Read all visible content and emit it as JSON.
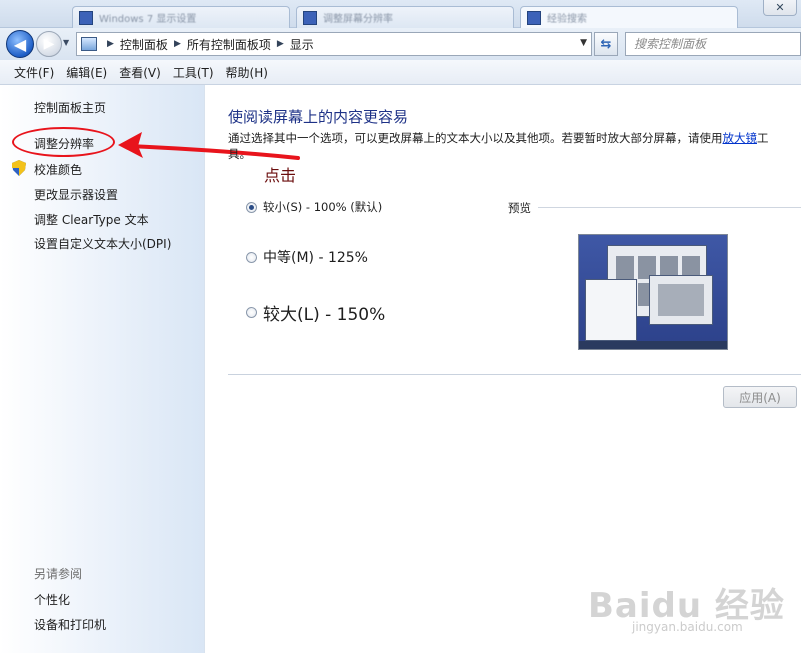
{
  "tabs": [
    {
      "label": "Windows 7 显示设置"
    },
    {
      "label": "调整屏幕分辨率"
    },
    {
      "label": "经验搜索"
    }
  ],
  "window": {
    "close_label": "✕"
  },
  "address": {
    "crumbs": [
      "控制面板",
      "所有控制面板项",
      "显示"
    ],
    "search_placeholder": "搜索控制面板"
  },
  "menu": [
    "文件(F)",
    "编辑(E)",
    "查看(V)",
    "工具(T)",
    "帮助(H)"
  ],
  "sidebar": {
    "home": "控制面板主页",
    "items": [
      {
        "label": "调整分辨率"
      },
      {
        "label": "校准颜色",
        "icon": "shield-icon"
      },
      {
        "label": "更改显示器设置"
      },
      {
        "label": "调整 ClearType 文本"
      },
      {
        "label": "设置自定义文本大小(DPI)"
      }
    ],
    "see_also_title": "另请参阅",
    "see_also": [
      "个性化",
      "设备和打印机"
    ]
  },
  "annotation": {
    "text": "点击",
    "color": "#e8141c"
  },
  "main": {
    "title": "使阅读屏幕上的内容更容易",
    "desc_before": "通过选择其中一个选项，可以更改屏幕上的文本大小以及其他项。若要暂时放大部分屏幕，请使用",
    "desc_link": "放大镜",
    "desc_after": "工具。",
    "options": [
      {
        "label": "较小(S) - 100% (默认)",
        "checked": true
      },
      {
        "label": "中等(M) - 125%",
        "checked": false
      },
      {
        "label": "较大(L) - 150%",
        "checked": false
      }
    ],
    "preview_label": "预览",
    "apply_label": "应用(A)"
  },
  "watermark": {
    "logo": "Baidu 经验",
    "url": "jingyan.baidu.com"
  },
  "colors": {
    "title_blue": "#1e3287",
    "link_blue": "#0033cc",
    "annotation_red": "#e8141c"
  }
}
